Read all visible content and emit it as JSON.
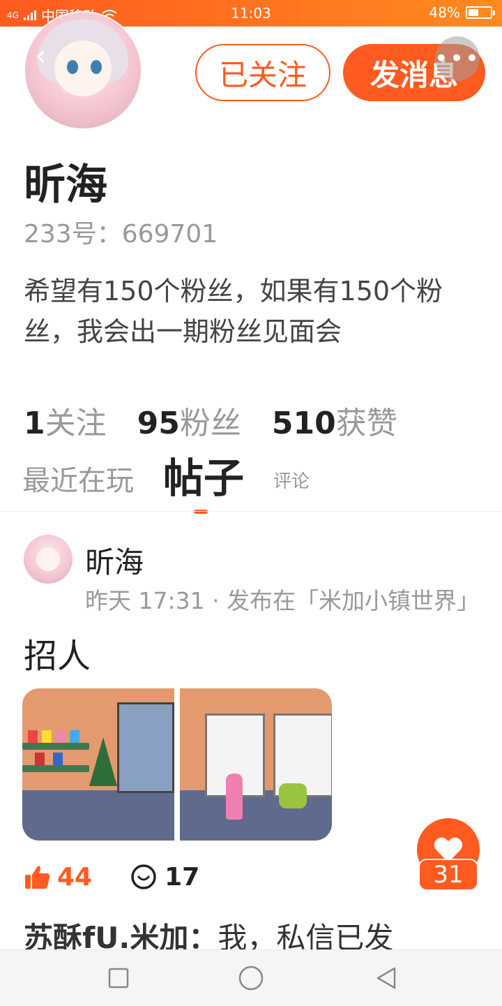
{
  "status_bar": {
    "network": "4G",
    "carrier": "中国移动",
    "time": "11:03",
    "battery": "48%",
    "battery_level": 0.48
  },
  "header": {
    "follow_label": "已关注",
    "message_label": "发消息"
  },
  "profile": {
    "name": "昕海",
    "id": "233号：669701",
    "bio": "希望有150个粉丝，如果有150个粉丝，我会出一期粉丝见面会",
    "stats": [
      {
        "value": "1",
        "label": "关注"
      },
      {
        "value": "95",
        "label": "粉丝"
      },
      {
        "value": "510",
        "label": "获赞"
      }
    ]
  },
  "tabs": {
    "recent": "最近在玩",
    "posts": "帖子",
    "comments": "评论"
  },
  "post": {
    "author": "昕海",
    "meta": "昨天 17:31 · 发布在「米加小镇世界」",
    "title": "招人",
    "likes": "44",
    "comments": "17",
    "floating_like_count": "31",
    "comment_preview": {
      "user": "苏酥fU.米加：",
      "text": "我，私信已发"
    }
  },
  "colors": {
    "accent": "#ff5a1f",
    "text_primary": "#222222",
    "text_secondary": "#999999"
  }
}
